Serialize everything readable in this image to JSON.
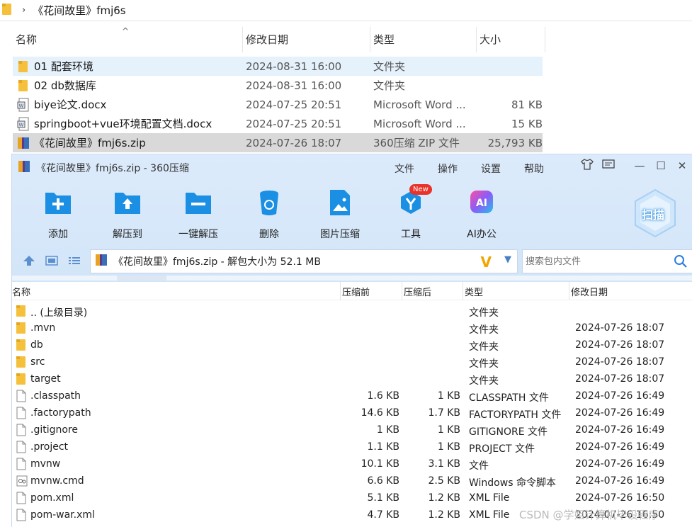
{
  "explorer": {
    "breadcrumb": "《花间故里》fmj6s",
    "columns": {
      "name": "名称",
      "date": "修改日期",
      "type": "类型",
      "size": "大小"
    },
    "rows": [
      {
        "name": "01 配套环境",
        "date": "2024-08-31 16:00",
        "type": "文件夹",
        "size": "",
        "icon": "folder-icon"
      },
      {
        "name": "02 db数据库",
        "date": "2024-08-31 16:00",
        "type": "文件夹",
        "size": "",
        "icon": "folder-icon"
      },
      {
        "name": "biye论文.docx",
        "date": "2024-07-25 20:51",
        "type": "Microsoft Word ...",
        "size": "81 KB",
        "icon": "word-doc-icon"
      },
      {
        "name": "springboot+vue环境配置文档.docx",
        "date": "2024-07-25 20:51",
        "type": "Microsoft Word ...",
        "size": "15 KB",
        "icon": "word-doc-icon"
      },
      {
        "name": "《花间故里》fmj6s.zip",
        "date": "2024-07-26 18:07",
        "type": "360压缩 ZIP 文件",
        "size": "25,793 KB",
        "icon": "zip-archive-icon"
      }
    ]
  },
  "zip": {
    "title": "《花间故里》fmj6s.zip - 360压缩",
    "menus": [
      "文件",
      "操作",
      "设置",
      "帮助"
    ],
    "toolbar": [
      {
        "label": "添加",
        "icon": "add-icon"
      },
      {
        "label": "解压到",
        "icon": "extract-to-icon"
      },
      {
        "label": "一键解压",
        "icon": "one-click-extract-icon"
      },
      {
        "label": "删除",
        "icon": "delete-icon"
      },
      {
        "label": "图片压缩",
        "icon": "image-compress-icon"
      },
      {
        "label": "工具",
        "icon": "tools-icon"
      },
      {
        "label": "AI办公",
        "icon": "ai-office-icon"
      }
    ],
    "new_badge": "New",
    "ai_icon_text": "AI",
    "scan_label": "扫描",
    "path_text": "《花间故里》fmj6s.zip - 解包大小为 52.1 MB",
    "search_placeholder": "搜索包内文件",
    "columns": {
      "name": "名称",
      "before": "压缩前",
      "after": "压缩后",
      "type": "类型",
      "date": "修改日期"
    },
    "rows": [
      {
        "name": ".. (上级目录)",
        "before": "",
        "after": "",
        "type": "文件夹",
        "date": "",
        "icon": "folder-icon"
      },
      {
        "name": ".mvn",
        "before": "",
        "after": "",
        "type": "文件夹",
        "date": "2024-07-26 18:07",
        "icon": "folder-icon"
      },
      {
        "name": "db",
        "before": "",
        "after": "",
        "type": "文件夹",
        "date": "2024-07-26 18:07",
        "icon": "folder-icon"
      },
      {
        "name": "src",
        "before": "",
        "after": "",
        "type": "文件夹",
        "date": "2024-07-26 18:07",
        "icon": "folder-icon"
      },
      {
        "name": "target",
        "before": "",
        "after": "",
        "type": "文件夹",
        "date": "2024-07-26 18:07",
        "icon": "folder-icon"
      },
      {
        "name": ".classpath",
        "before": "1.6 KB",
        "after": "1 KB",
        "type": "CLASSPATH 文件",
        "date": "2024-07-26 16:49",
        "icon": "file-icon"
      },
      {
        "name": ".factorypath",
        "before": "14.6 KB",
        "after": "1.7 KB",
        "type": "FACTORYPATH 文件",
        "date": "2024-07-26 16:49",
        "icon": "file-icon"
      },
      {
        "name": ".gitignore",
        "before": "1 KB",
        "after": "1 KB",
        "type": "GITIGNORE 文件",
        "date": "2024-07-26 16:49",
        "icon": "file-icon"
      },
      {
        "name": ".project",
        "before": "1.1 KB",
        "after": "1 KB",
        "type": "PROJECT 文件",
        "date": "2024-07-26 16:49",
        "icon": "file-icon"
      },
      {
        "name": "mvnw",
        "before": "10.1 KB",
        "after": "3.1 KB",
        "type": "文件",
        "date": "2024-07-26 16:49",
        "icon": "file-icon"
      },
      {
        "name": "mvnw.cmd",
        "before": "6.6 KB",
        "after": "2.5 KB",
        "type": "Windows 命令脚本",
        "date": "2024-07-26 16:49",
        "icon": "cmd-script-icon"
      },
      {
        "name": "pom.xml",
        "before": "5.1 KB",
        "after": "1.2 KB",
        "type": "XML File",
        "date": "2024-07-26 16:50",
        "icon": "file-icon"
      },
      {
        "name": "pom-war.xml",
        "before": "4.7 KB",
        "after": "1.2 KB",
        "type": "XML File",
        "date": "2024-07-26 16:50",
        "icon": "file-icon"
      }
    ]
  },
  "watermark": "CSDN @学姐计算机毕设程序",
  "colors": {
    "explorer_selection": "#e5f1fb",
    "zip_selection": "#d9d9d9",
    "toolbar_bg": "#d6e8fa",
    "icon_blue": "#1a8fe3"
  }
}
